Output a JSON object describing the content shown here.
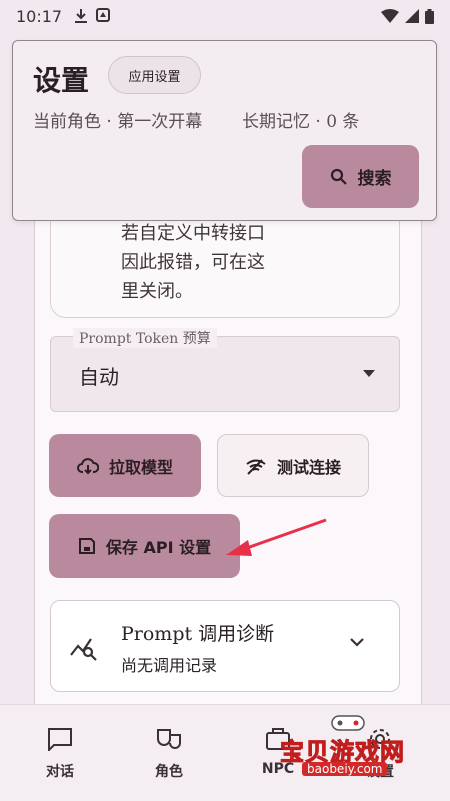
{
  "status_bar": {
    "time": "10:17"
  },
  "header": {
    "title": "设置",
    "chip": "应用设置",
    "role_info": "当前角色 · 第一次开幕",
    "memory_info": "长期记忆 · 0 条",
    "search_label": "搜索"
  },
  "previous_card": {
    "text": "若自定义中转接口\n因此报错，可在这\n里关闭。"
  },
  "token_budget": {
    "label": "Prompt Token 预算",
    "value": "自动"
  },
  "buttons": {
    "fetch_models": "拉取模型",
    "test_connection": "测试连接",
    "save_api": "保存 API 设置"
  },
  "diagnostics": {
    "title": "Prompt 调用诊断",
    "subtitle": "尚无调用记录"
  },
  "bottom_nav": {
    "items": [
      {
        "label": "对话",
        "icon": "chat-icon"
      },
      {
        "label": "角色",
        "icon": "masks-icon"
      },
      {
        "label": "NPC",
        "icon": "npc-icon"
      },
      {
        "label": "设置",
        "icon": "settings-icon"
      }
    ]
  },
  "watermark": {
    "text": "宝贝游戏网",
    "url": "baobeiy.com"
  },
  "colors": {
    "accent": "#b98a9d",
    "annotation_arrow": "#e8304a",
    "background": "#f1e9ef"
  }
}
